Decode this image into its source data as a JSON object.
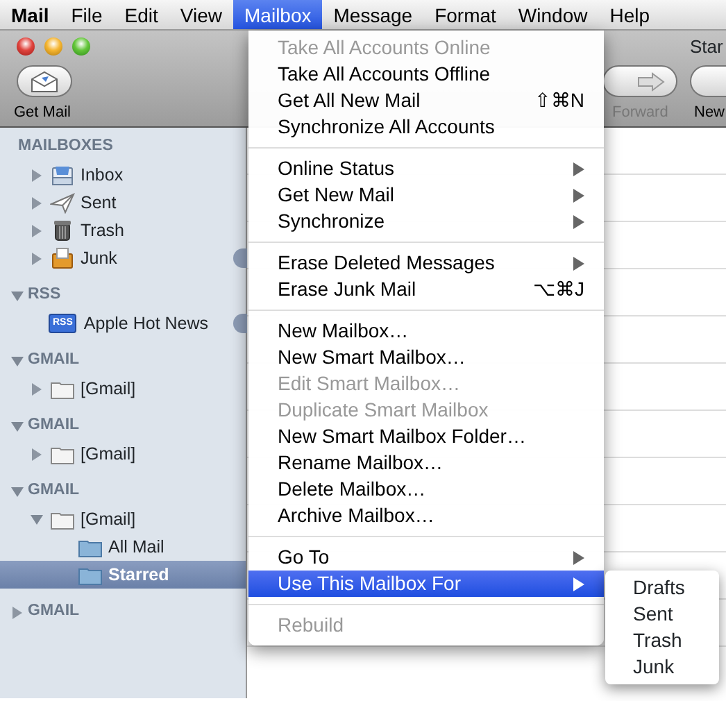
{
  "menubar": [
    {
      "label": "Mail",
      "selected": false,
      "bold": true
    },
    {
      "label": "File",
      "selected": false
    },
    {
      "label": "Edit",
      "selected": false
    },
    {
      "label": "View",
      "selected": false
    },
    {
      "label": "Mailbox",
      "selected": true
    },
    {
      "label": "Message",
      "selected": false
    },
    {
      "label": "Format",
      "selected": false
    },
    {
      "label": "Window",
      "selected": false
    },
    {
      "label": "Help",
      "selected": false
    }
  ],
  "window": {
    "title": "Star",
    "toolbar": [
      {
        "label": "Get Mail",
        "kind": "get-mail",
        "disabled": false
      },
      {
        "label": "Forward",
        "kind": "forward",
        "disabled": true
      },
      {
        "label": "New",
        "kind": "new",
        "disabled": false
      }
    ]
  },
  "sidebar": {
    "sections": [
      {
        "title": "MAILBOXES",
        "items": [
          {
            "label": "Inbox",
            "kind": "inbox",
            "expanded": false,
            "selected": false,
            "badge": false
          },
          {
            "label": "Sent",
            "kind": "sent",
            "expanded": false,
            "selected": false,
            "badge": false
          },
          {
            "label": "Trash",
            "kind": "trash",
            "expanded": false,
            "selected": false,
            "badge": false
          },
          {
            "label": "Junk",
            "kind": "junk",
            "expanded": false,
            "selected": false,
            "badge": true
          }
        ]
      },
      {
        "title": "RSS",
        "expanded": true,
        "items": [
          {
            "label": "Apple Hot News",
            "kind": "rss",
            "icon_label": "RSS",
            "selected": false,
            "badge": true
          }
        ]
      },
      {
        "title": "GMAIL",
        "expanded": true,
        "items": [
          {
            "label": "[Gmail]",
            "kind": "folder",
            "expanded": false,
            "selected": false,
            "badge": false
          }
        ]
      },
      {
        "title": "GMAIL",
        "expanded": true,
        "items": [
          {
            "label": "[Gmail]",
            "kind": "folder",
            "expanded": false,
            "selected": false,
            "badge": false
          }
        ]
      },
      {
        "title": "GMAIL",
        "expanded": true,
        "items": [
          {
            "label": "[Gmail]",
            "kind": "folder",
            "expanded": true,
            "selected": false,
            "badge": false,
            "children": [
              {
                "label": "All Mail",
                "kind": "mailbox",
                "selected": false,
                "badge": false
              },
              {
                "label": "Starred",
                "kind": "mailbox",
                "selected": true,
                "badge": false
              }
            ]
          }
        ]
      },
      {
        "title": "GMAIL",
        "expanded": false
      }
    ]
  },
  "menu": {
    "items": [
      {
        "kind": "item",
        "label": "Take All Accounts Online",
        "disabled": true
      },
      {
        "kind": "item",
        "label": "Take All Accounts Offline",
        "disabled": false
      },
      {
        "kind": "item",
        "label": "Get All New Mail",
        "disabled": false,
        "shortcut": "⇧⌘N"
      },
      {
        "kind": "item",
        "label": "Synchronize All Accounts",
        "disabled": false
      },
      {
        "kind": "separator"
      },
      {
        "kind": "item",
        "label": "Online Status",
        "disabled": false,
        "submenu": true
      },
      {
        "kind": "item",
        "label": "Get New Mail",
        "disabled": false,
        "submenu": true
      },
      {
        "kind": "item",
        "label": "Synchronize",
        "disabled": false,
        "submenu": true
      },
      {
        "kind": "separator"
      },
      {
        "kind": "item",
        "label": "Erase Deleted Messages",
        "disabled": false,
        "submenu": true
      },
      {
        "kind": "item",
        "label": "Erase Junk Mail",
        "disabled": false,
        "shortcut": "⌥⌘J"
      },
      {
        "kind": "separator"
      },
      {
        "kind": "item",
        "label": "New Mailbox…",
        "disabled": false
      },
      {
        "kind": "item",
        "label": "New Smart Mailbox…",
        "disabled": false
      },
      {
        "kind": "item",
        "label": "Edit Smart Mailbox…",
        "disabled": true
      },
      {
        "kind": "item",
        "label": "Duplicate Smart Mailbox",
        "disabled": true
      },
      {
        "kind": "item",
        "label": "New Smart Mailbox Folder…",
        "disabled": false
      },
      {
        "kind": "item",
        "label": "Rename Mailbox…",
        "disabled": false
      },
      {
        "kind": "item",
        "label": "Delete Mailbox…",
        "disabled": false
      },
      {
        "kind": "item",
        "label": "Archive Mailbox…",
        "disabled": false
      },
      {
        "kind": "separator"
      },
      {
        "kind": "item",
        "label": "Go To",
        "disabled": false,
        "submenu": true
      },
      {
        "kind": "item",
        "label": "Use This Mailbox For",
        "disabled": false,
        "submenu": true,
        "selected": true
      },
      {
        "kind": "separator"
      },
      {
        "kind": "item",
        "label": "Rebuild",
        "disabled": true
      }
    ]
  },
  "submenu": {
    "items": [
      {
        "label": "Drafts"
      },
      {
        "label": "Sent"
      },
      {
        "label": "Trash"
      },
      {
        "label": "Junk"
      }
    ]
  }
}
